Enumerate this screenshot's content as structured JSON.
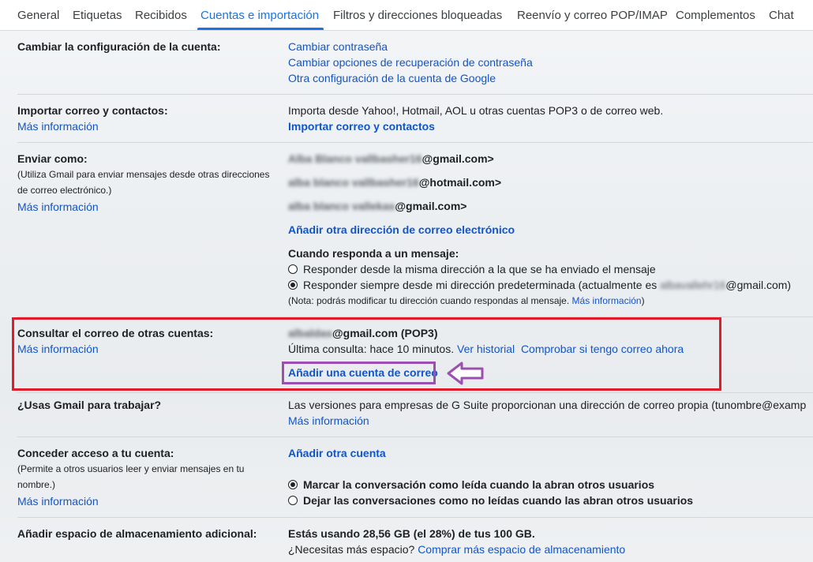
{
  "tabs": [
    "General",
    "Etiquetas",
    "Recibidos",
    "Cuentas e importación",
    "Filtros y direcciones bloqueadas",
    "Reenvío y correo POP/IMAP",
    "Complementos",
    "Chat"
  ],
  "account": {
    "label": "Cambiar la configuración de la cuenta:",
    "links": [
      "Cambiar contraseña",
      "Cambiar opciones de recuperación de contraseña",
      "Otra configuración de la cuenta de Google"
    ]
  },
  "import": {
    "label": "Importar correo y contactos:",
    "more": "Más información",
    "desc": "Importa desde Yahoo!, Hotmail, AOL u otras cuentas POP3 o de correo web.",
    "action": "Importar correo y contactos"
  },
  "send_as": {
    "label": "Enviar como:",
    "note1": "(Utiliza Gmail para enviar mensajes desde otras direcciones",
    "note2": "de correo electrónico.)",
    "more": "Más información",
    "addresses": [
      {
        "blurred": "Alba Blanco vallbasher16",
        "visible": "@gmail.com>"
      },
      {
        "blurred": "alba blanco vallbasher16",
        "visible": "@hotmail.com>"
      },
      {
        "blurred": "alba blanco vallekas",
        "visible": "@gmail.com>"
      }
    ],
    "add_link": "Añadir otra dirección de correo electrónico",
    "reply_title": "Cuando responda a un mensaje:",
    "reply_opt1": "Responder desde la misma dirección a la que se ha enviado el mensaje",
    "reply_opt2_pre": "Responder siempre desde mi dirección predeterminada (actualmente es",
    "reply_opt2_blur": "albavallehr16",
    "reply_opt2_post": "@gmail.com)",
    "reply_note": "(Nota: podrás modificar tu dirección cuando respondas al mensaje.",
    "reply_note_link": "Más información",
    "reply_note_end": ")"
  },
  "check_mail": {
    "label": "Consultar el correo de otras cuentas:",
    "more": "Más información",
    "account_blur": "albaldas",
    "account_visible": "@gmail.com (POP3)",
    "last_check": "Última consulta: hace 10 minutos.",
    "history": "Ver historial",
    "check_now": "Comprobar si tengo correo ahora",
    "add_account": "Añadir una cuenta de correo"
  },
  "work": {
    "label": "¿Usas Gmail para trabajar?",
    "desc": "Las versiones para empresas de G Suite proporcionan una dirección de correo propia (tunombre@examp",
    "more": "Más información"
  },
  "grant": {
    "label": "Conceder acceso a tu cuenta:",
    "note1": "(Permite a otros usuarios leer y enviar mensajes en tu",
    "note2": "nombre.)",
    "more": "Más información",
    "add": "Añadir otra cuenta",
    "opt1": "Marcar la conversación como leída cuando la abran otros usuarios",
    "opt2": "Dejar las conversaciones como no leídas cuando las abran otros usuarios"
  },
  "storage": {
    "label": "Añadir espacio de almacenamiento adicional:",
    "usage": "Estás usando 28,56 GB (el 28%) de tus 100 GB.",
    "need": "¿Necesitas más espacio?",
    "buy": "Comprar más espacio de almacenamiento"
  }
}
